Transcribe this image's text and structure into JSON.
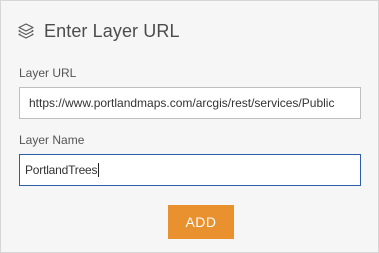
{
  "header": {
    "title": "Enter Layer URL",
    "icon": "layers-icon"
  },
  "form": {
    "url_label": "Layer URL",
    "url_value": "https://www.portlandmaps.com/arcgis/rest/services/Public",
    "name_label": "Layer Name",
    "name_value": "PortlandTrees"
  },
  "actions": {
    "add_label": "ADD"
  },
  "colors": {
    "accent_button": "#e8912e",
    "focus_border": "#2d5eaa",
    "panel_background": "#f6f6f6"
  }
}
